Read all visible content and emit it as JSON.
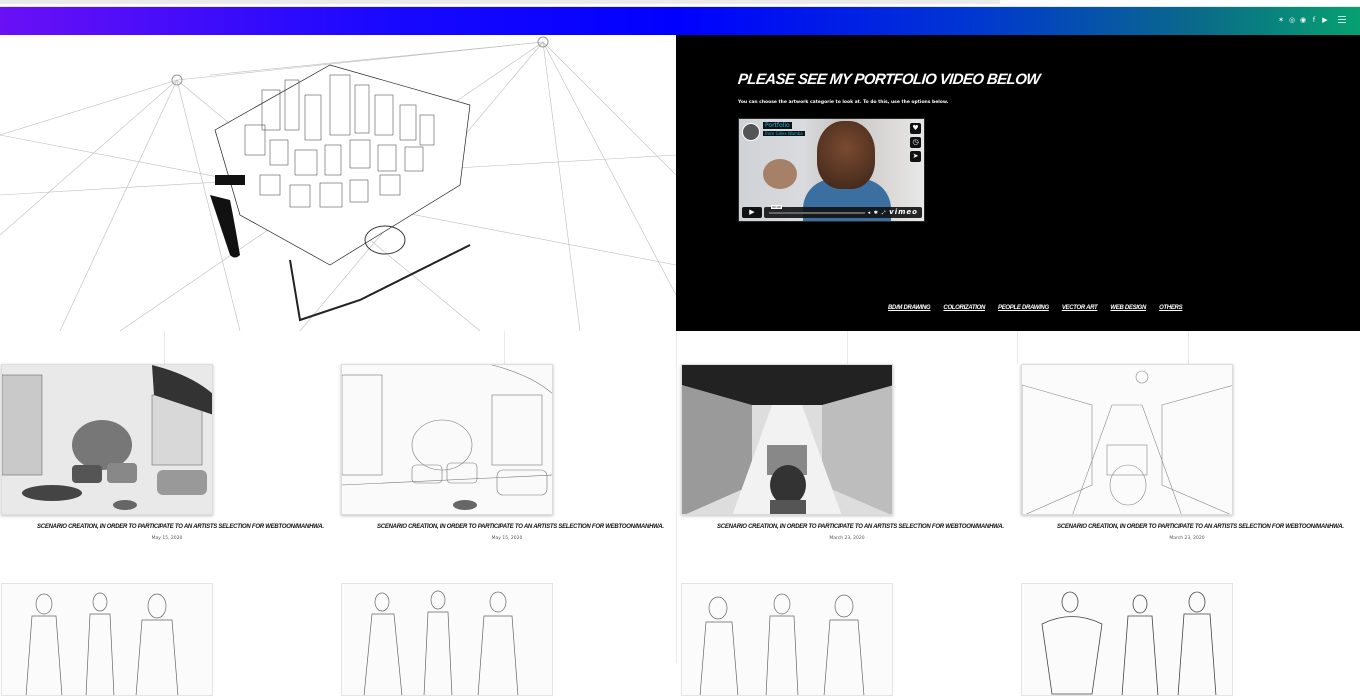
{
  "header": {
    "social_icons": [
      "behance-icon",
      "instagram-icon",
      "dribbble-icon",
      "facebook-icon",
      "youtube-icon"
    ],
    "social_glyphs": [
      "✶",
      "◎",
      "◉",
      "f",
      "▶"
    ],
    "gradient_colors": [
      "#6a10f5",
      "#0000ff",
      "#07a070"
    ]
  },
  "hero": {
    "title": "PLEASE SEE MY PORTFOLIO VIDEO BELOW",
    "subtitle": "You can choose the artwork categorie to look at. To do this, use the options below.",
    "video": {
      "title": "Portfolio",
      "author": "from Gilles Wamba",
      "time": "00:00",
      "brand": "vimeo"
    },
    "categories": [
      "BD/M DRAWING",
      "COLORIZATION",
      "PEOPLE DRAWING",
      "VECTOR ART",
      "WEB DESIGN",
      "OTHERS"
    ]
  },
  "posts": [
    {
      "caption": "SCENARIO CREATION, IN ORDER TO PARTICIPATE TO AN ARTISTS SELECTION FOR WEBTOON/MANHWA.",
      "date": "May 15, 2020"
    },
    {
      "caption": "SCENARIO CREATION, IN ORDER TO PARTICIPATE TO AN ARTISTS SELECTION FOR WEBTOON/MANHWA.",
      "date": "May 15, 2020"
    },
    {
      "caption": "SCENARIO CREATION, IN ORDER TO PARTICIPATE TO AN ARTISTS SELECTION FOR WEBTOON/MANHWA.",
      "date": "March 23, 2020"
    },
    {
      "caption": "SCENARIO CREATION, IN ORDER TO PARTICIPATE TO AN ARTISTS SELECTION FOR WEBTOON/MANHWA.",
      "date": "March 23, 2020"
    }
  ]
}
